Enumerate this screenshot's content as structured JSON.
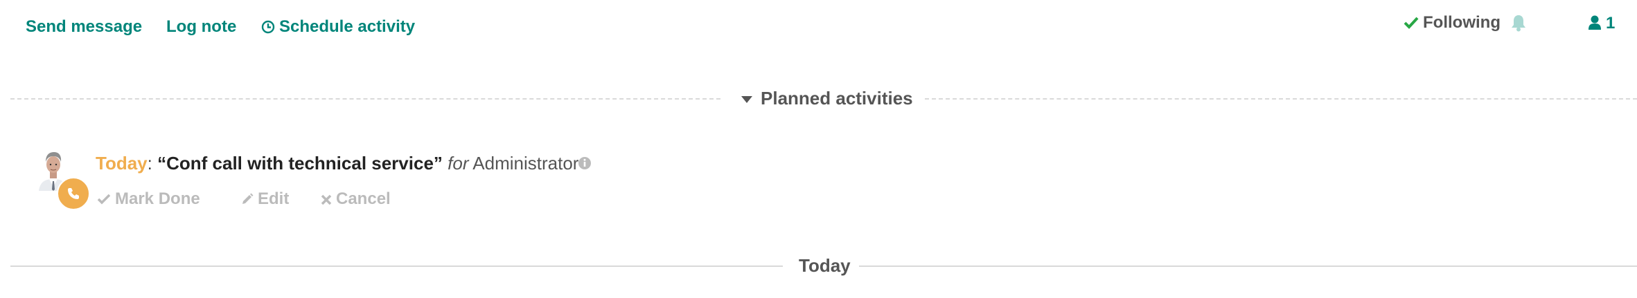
{
  "colors": {
    "accent": "#00857a",
    "today": "#f0ad4e",
    "muted": "#bbbbbb",
    "text": "#555555"
  },
  "topbar": {
    "send_message": "Send message",
    "log_note": "Log note",
    "schedule_activity": "Schedule activity",
    "following": "Following",
    "followers_count": "1"
  },
  "separators": {
    "planned_activities": "Planned activities",
    "today": "Today"
  },
  "activity": {
    "date_label": "Today",
    "colon": ":",
    "summary": "“Conf call with technical service”",
    "for_label": "for",
    "assignee": "Administrator",
    "type_icon": "phone-icon",
    "buttons": {
      "mark_done": "Mark Done",
      "edit": "Edit",
      "cancel": "Cancel"
    }
  }
}
